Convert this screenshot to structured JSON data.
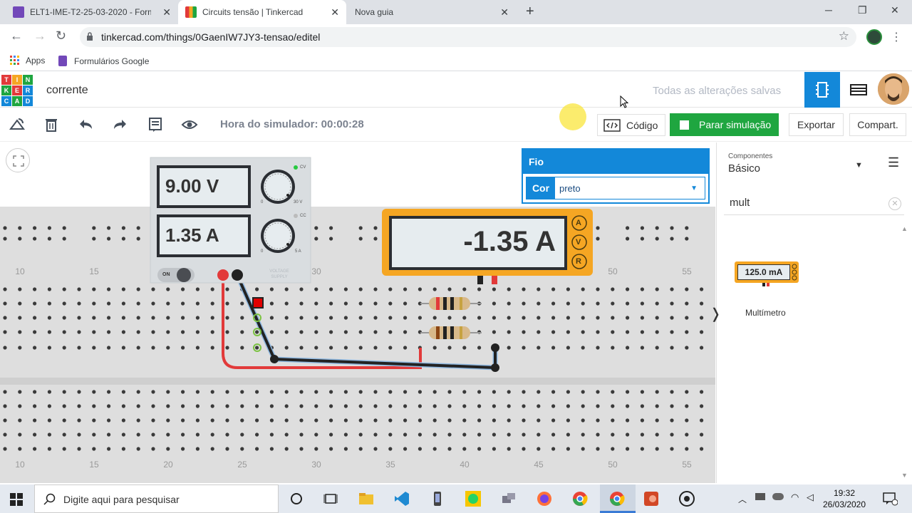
{
  "browser": {
    "tabs": [
      {
        "title": "ELT1-IME-T2-25-03-2020 - Formu"
      },
      {
        "title": "Circuits tensão | Tinkercad"
      },
      {
        "title": "Nova guia"
      }
    ],
    "url": "tinkercad.com/things/0GaenIW7JY3-tensao/editel",
    "bookmarks": [
      "Apps",
      "Formulários Google"
    ]
  },
  "app": {
    "logo_letters": [
      "T",
      "I",
      "N",
      "K",
      "E",
      "R",
      "C",
      "A",
      "D"
    ],
    "project_name": "corrente",
    "save_status": "Todas as alterações salvas"
  },
  "toolbar": {
    "sim_time": "Hora do simulador: 00:00:28",
    "code_label": "Código",
    "stop_label": "Parar simulação",
    "export_label": "Exportar",
    "share_label": "Compart."
  },
  "power_supply": {
    "voltage": "9.00 V",
    "current": "1.35 A",
    "on_label": "ON",
    "label": "VOLTAGE SUPPLY",
    "v_max": "30 V",
    "a_max": "5 A",
    "v_min": "0",
    "a_min": "0",
    "cv": "CV",
    "cc": "CC"
  },
  "multimeter": {
    "reading": "-1.35 A",
    "modes": [
      "A",
      "V",
      "R"
    ]
  },
  "breadboard": {
    "col_numbers": [
      "10",
      "15",
      "20",
      "25",
      "30",
      "35",
      "40",
      "45",
      "50",
      "55"
    ]
  },
  "wire_panel": {
    "title": "Fio",
    "color_label": "Cor",
    "color_value": "preto"
  },
  "components_panel": {
    "category_label": "Componentes",
    "category_value": "Básico",
    "search_value": "mult",
    "item_reading": "125.0 mA",
    "item_name": "Multímetro"
  },
  "taskbar": {
    "search_placeholder": "Digite aqui para pesquisar",
    "time": "19:32",
    "date": "26/03/2020"
  },
  "colors": {
    "tinkercad_blue": "#1388d9",
    "sim_green": "#1fa640",
    "multimeter_orange": "#f5a623",
    "wire_red": "#e23a3a",
    "wire_black": "#222222"
  }
}
